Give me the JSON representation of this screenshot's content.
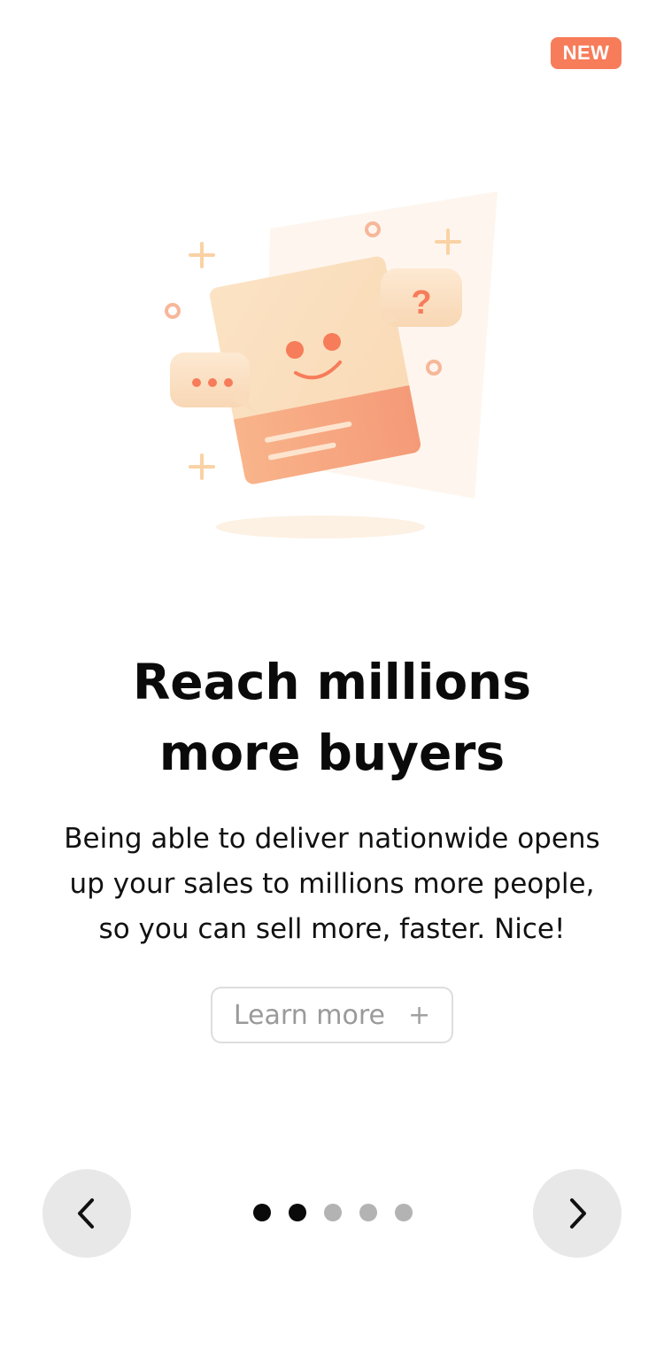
{
  "badge": {
    "label": "NEW"
  },
  "onboarding": {
    "headline_line1": "Reach millions",
    "headline_line2": "more buyers",
    "description_line1": "Being able to deliver nationwide opens",
    "description_line2": "up your sales to millions more people,",
    "description_line3": "so you can sell more, faster. Nice!",
    "learn_more_label": "Learn more",
    "learn_more_icon": "+"
  },
  "illustration": {
    "question_mark": "?",
    "ellipsis_icon": "dots-icon",
    "accent_color": "#f77c5a"
  },
  "pagination": {
    "total": 5,
    "current": 2
  },
  "navigation": {
    "prev_icon": "chevron-left-icon",
    "next_icon": "chevron-right-icon"
  },
  "colors": {
    "accent": "#f77c5a",
    "dot_active": "#0a0a0a",
    "dot_inactive": "#b3b3b3",
    "nav_button_bg": "#e8e8e8"
  }
}
